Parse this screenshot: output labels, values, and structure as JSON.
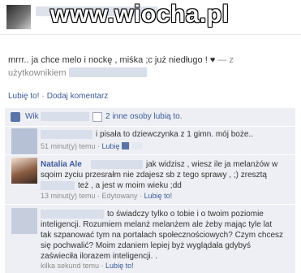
{
  "watermark": "www.wiocha.pl",
  "post": {
    "text": "mrrr.. ja chce melo i nockę , miśka ;c już niedługo ! ♥",
    "from_sep": "— z",
    "from_label": "użytkownikiem"
  },
  "actions": {
    "like": "Lubię to!",
    "sep": "·",
    "comment": "Dodaj komentarz"
  },
  "likes": {
    "prefix": "Wik",
    "others": "2 inne osoby lubią to.",
    "icon": "thumbs-up-icon"
  },
  "comments": [
    {
      "text": "i pisała to dziewczynka z 1 gimn. mój boże..",
      "time": "51 minut(y) temu",
      "like": "Lubię to!"
    },
    {
      "name": "Natalia Ale",
      "text_1": "jak widzisz , wiesz ile ja melanżów w",
      "text_2": "sqoim zyciu przesrałm nie zdajesz sb z tego sprawy , ;) zresztą",
      "text_3a": "też , a jest w moim wieku ;dd",
      "time": "13 minut(y) temu",
      "edited": "Edytowany",
      "like": "Lubię to!"
    },
    {
      "text_1": "to świadczy tylko o tobie i o twoim poziomie",
      "text_2": "inteligencji. Rozumiem melanż melanżem ale żeby mając tyle lat",
      "text_3": "tak szpanować tym na portalach społecznościowych? Czym chcesz",
      "text_4": "się pochwalić? Moim zdaniem lepiej byż wyglądała gdybyś",
      "text_5": "zaświeciła ilorazem inteligencji. .",
      "time": "kilka sekund temu",
      "like": "Lubię to!"
    }
  ],
  "colors": {
    "link": "#3b5998",
    "panel": "#edeff4"
  }
}
